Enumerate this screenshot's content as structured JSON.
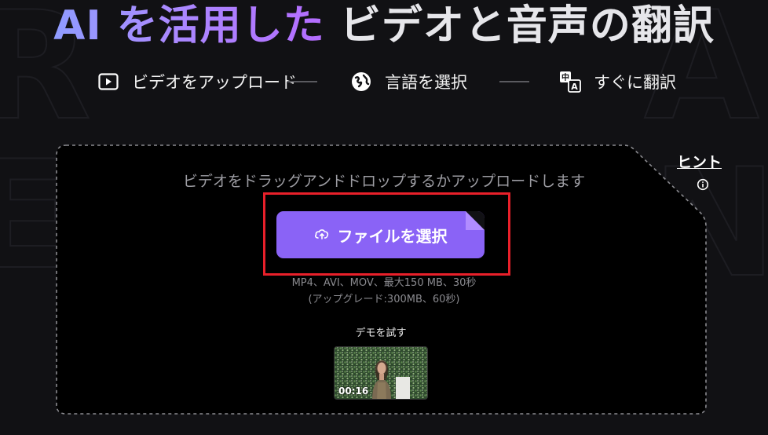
{
  "hero": {
    "title_highlight": "AI を活用した",
    "title_rest": " ビデオと音声の翻訳"
  },
  "steps": [
    {
      "icon": "play-icon",
      "label": "ビデオをアップロード"
    },
    {
      "icon": "globe-icon",
      "label": "言語を選択"
    },
    {
      "icon": "translate-icon",
      "label": "すぐに翻訳"
    }
  ],
  "hint": {
    "label": "ヒント",
    "icon": "info-icon"
  },
  "upload": {
    "drop_text": "ビデオをドラッグアンドドロップするかアップロードします",
    "button_label": "ファイルを選択",
    "button_icon": "cloud-upload-icon",
    "formats_line1": "MP4、AVI、MOV、最大150 MB、30秒",
    "formats_line2": "(アップグレード:300MB、60秒)"
  },
  "demo": {
    "label": "デモを試す",
    "duration": "00:16"
  },
  "colors": {
    "accent": "#8a63f6",
    "highlight_border": "#e8202a",
    "background": "#111114"
  }
}
